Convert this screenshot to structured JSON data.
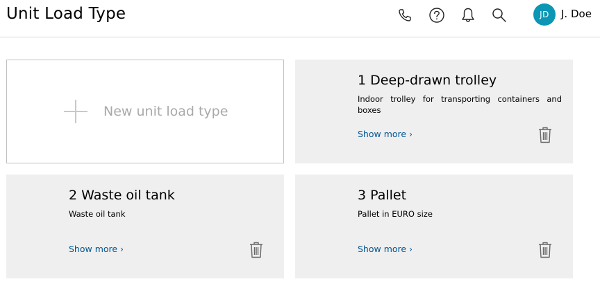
{
  "header": {
    "title": "Unit Load Type",
    "icons": [
      "phone-icon",
      "help-icon",
      "bell-icon",
      "search-icon"
    ],
    "user": {
      "initials": "JD",
      "name": "J. Doe",
      "avatar_color": "#0a96b4"
    }
  },
  "new_card": {
    "label": "New unit load type"
  },
  "cards": [
    {
      "title": "1 Deep-drawn trolley",
      "description": "Indoor trolley for transporting containers and boxes",
      "show_more": "Show more"
    },
    {
      "title": "2 Waste oil tank",
      "description": "Waste oil tank",
      "show_more": "Show more"
    },
    {
      "title": "3 Pallet",
      "description": "Pallet in EURO size",
      "show_more": "Show more"
    }
  ],
  "colors": {
    "card_bg": "#efefef",
    "link": "#005691",
    "border": "#bfc0c2"
  }
}
